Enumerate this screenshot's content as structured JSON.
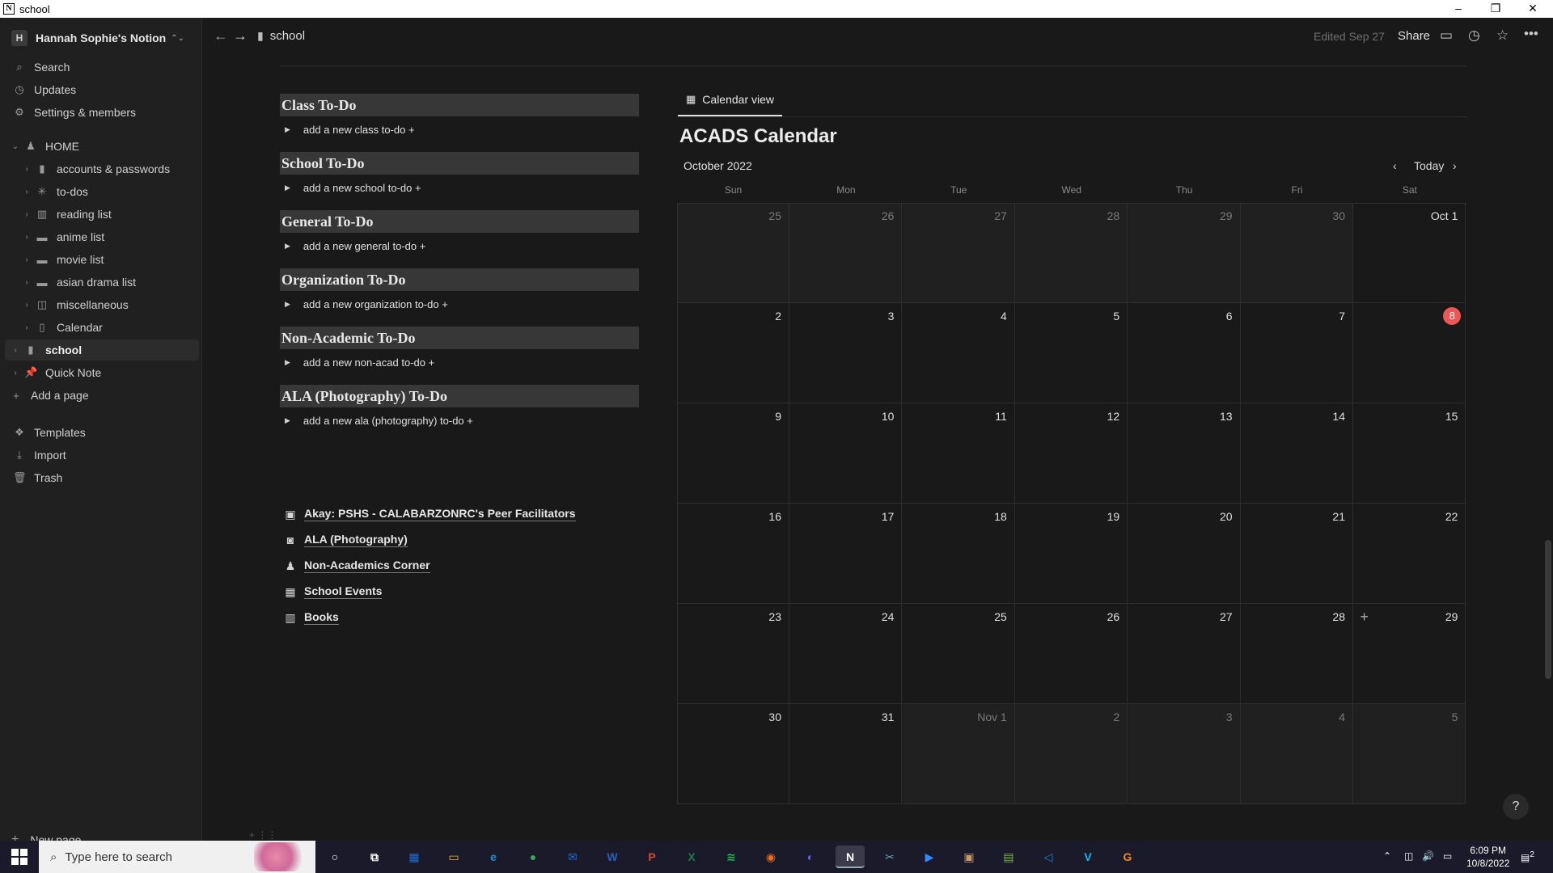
{
  "window": {
    "title": "school",
    "app_icon": "N"
  },
  "sidebar": {
    "workspace": {
      "avatar": "H",
      "name": "Hannah Sophie's Notion"
    },
    "top_items": [
      {
        "icon": "search-icon",
        "label": "Search"
      },
      {
        "icon": "clock-icon",
        "label": "Updates"
      },
      {
        "icon": "gear-icon",
        "label": "Settings & members"
      }
    ],
    "home": "HOME",
    "pages": [
      "accounts & passwords",
      "to-dos",
      "reading list",
      "anime list",
      "movie list",
      "asian drama list",
      "miscellaneous",
      "Calendar"
    ],
    "school": "school",
    "quick_note": "Quick Note",
    "add_page": "Add a page",
    "bottom_items": [
      "Templates",
      "Import",
      "Trash"
    ],
    "new_page": "New page"
  },
  "topbar": {
    "breadcrumb": "school",
    "edited": "Edited Sep 27",
    "share": "Share"
  },
  "todos": [
    {
      "heading": "Class To-Do",
      "item": "add a new class to-do +"
    },
    {
      "heading": "School To-Do",
      "item": "add a new school to-do +"
    },
    {
      "heading": "General To-Do",
      "item": "add a new general to-do +"
    },
    {
      "heading": "Organization To-Do",
      "item": "add a new organization to-do +"
    },
    {
      "heading": "Non-Academic To-Do",
      "item": "add a new non-acad to-do +"
    },
    {
      "heading": "ALA (Photography) To-Do",
      "item": "add a new ala (photography) to-do +"
    }
  ],
  "links": [
    {
      "icon": "badge-icon",
      "label": "Akay: PSHS - CALABARZONRC's Peer Facilitators"
    },
    {
      "icon": "camera-icon",
      "label": "ALA (Photography)"
    },
    {
      "icon": "person-icon",
      "label": "Non-Academics Corner"
    },
    {
      "icon": "calendar-icon",
      "label": "School Events"
    },
    {
      "icon": "book-icon",
      "label": "Books"
    }
  ],
  "calendar": {
    "view_tab": "Calendar view",
    "title": "ACADS Calendar",
    "month": "October 2022",
    "today_label": "Today",
    "weekdays": [
      "Sun",
      "Mon",
      "Tue",
      "Wed",
      "Thu",
      "Fri",
      "Sat"
    ],
    "weeks": [
      [
        {
          "d": "25",
          "out": true
        },
        {
          "d": "26",
          "out": true
        },
        {
          "d": "27",
          "out": true
        },
        {
          "d": "28",
          "out": true
        },
        {
          "d": "29",
          "out": true
        },
        {
          "d": "30",
          "out": true
        },
        {
          "d": "Oct 1"
        }
      ],
      [
        {
          "d": "2"
        },
        {
          "d": "3"
        },
        {
          "d": "4"
        },
        {
          "d": "5"
        },
        {
          "d": "6"
        },
        {
          "d": "7"
        },
        {
          "d": "8",
          "today": true
        }
      ],
      [
        {
          "d": "9"
        },
        {
          "d": "10"
        },
        {
          "d": "11"
        },
        {
          "d": "12"
        },
        {
          "d": "13"
        },
        {
          "d": "14"
        },
        {
          "d": "15"
        }
      ],
      [
        {
          "d": "16"
        },
        {
          "d": "17"
        },
        {
          "d": "18"
        },
        {
          "d": "19"
        },
        {
          "d": "20"
        },
        {
          "d": "21"
        },
        {
          "d": "22"
        }
      ],
      [
        {
          "d": "23"
        },
        {
          "d": "24"
        },
        {
          "d": "25"
        },
        {
          "d": "26"
        },
        {
          "d": "27"
        },
        {
          "d": "28"
        },
        {
          "d": "29",
          "plus": true
        }
      ],
      [
        {
          "d": "30"
        },
        {
          "d": "31"
        },
        {
          "d": "Nov 1",
          "out": true
        },
        {
          "d": "2",
          "out": true
        },
        {
          "d": "3",
          "out": true
        },
        {
          "d": "4",
          "out": true
        },
        {
          "d": "5",
          "out": true
        }
      ]
    ]
  },
  "taskbar": {
    "search_placeholder": "Type here to search",
    "apps": [
      {
        "name": "cortana",
        "glyph": "○",
        "color": "transparent"
      },
      {
        "name": "task-view",
        "glyph": "⧉",
        "color": "transparent"
      },
      {
        "name": "store",
        "glyph": "▦",
        "color": "#1e6ed6"
      },
      {
        "name": "file-explorer",
        "glyph": "▭",
        "color": "#e8b53a"
      },
      {
        "name": "edge",
        "glyph": "e",
        "color": "#1b8fd6"
      },
      {
        "name": "chrome",
        "glyph": "●",
        "color": "#3aa657"
      },
      {
        "name": "mail",
        "glyph": "✉",
        "color": "#1e6ed6"
      },
      {
        "name": "word",
        "glyph": "W",
        "color": "#2b5eb8"
      },
      {
        "name": "powerpoint",
        "glyph": "P",
        "color": "#d04a2a"
      },
      {
        "name": "excel",
        "glyph": "X",
        "color": "#1f7a45"
      },
      {
        "name": "spotify",
        "glyph": "≋",
        "color": "#1db954"
      },
      {
        "name": "firefox",
        "glyph": "◉",
        "color": "#e66a1f"
      },
      {
        "name": "discord",
        "glyph": "◐",
        "color": "#5865f2"
      },
      {
        "name": "notion",
        "glyph": "N",
        "color": "#ffffff",
        "active": true
      },
      {
        "name": "snip",
        "glyph": "✂",
        "color": "#6aa0c8"
      },
      {
        "name": "zoom",
        "glyph": "▶",
        "color": "#2d8cff"
      },
      {
        "name": "photos",
        "glyph": "▣",
        "color": "#c89a6a"
      },
      {
        "name": "notepad",
        "glyph": "▤",
        "color": "#7ab648"
      },
      {
        "name": "vscode",
        "glyph": "◁",
        "color": "#1f8ad2"
      },
      {
        "name": "vimeo",
        "glyph": "V",
        "color": "#1ab7ea"
      },
      {
        "name": "app-orange",
        "glyph": "G",
        "color": "#f08a1e"
      }
    ],
    "time": "6:09 PM",
    "date": "10/8/2022",
    "notifications": "2"
  }
}
